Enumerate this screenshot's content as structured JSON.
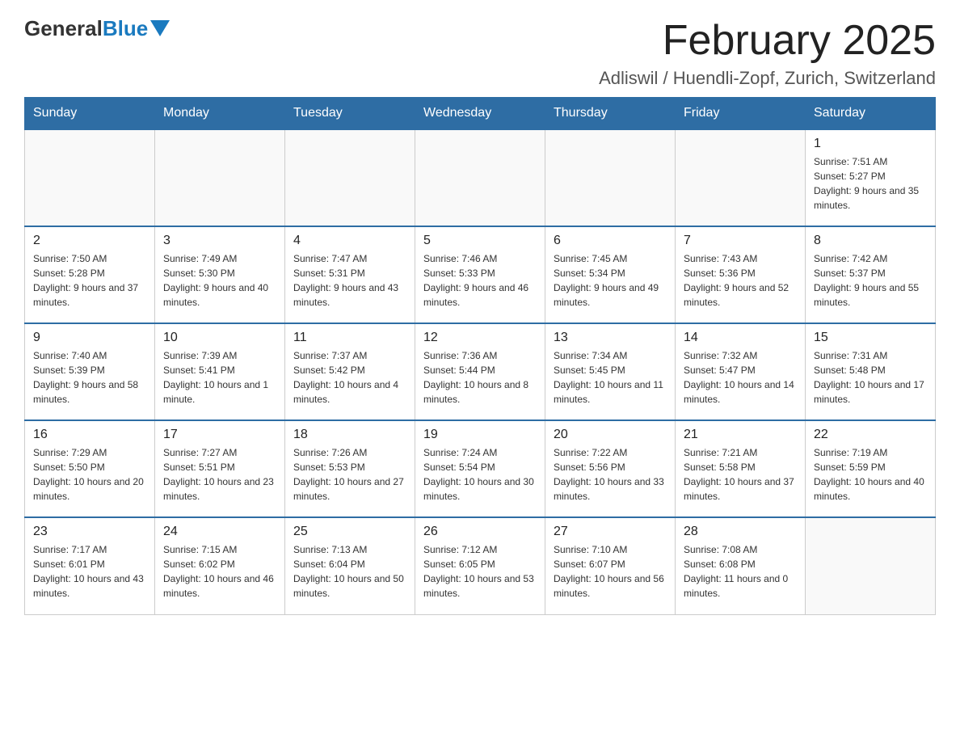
{
  "header": {
    "logo": {
      "general": "General",
      "blue": "Blue"
    },
    "title": "February 2025",
    "location": "Adliswil / Huendli-Zopf, Zurich, Switzerland"
  },
  "weekdays": [
    "Sunday",
    "Monday",
    "Tuesday",
    "Wednesday",
    "Thursday",
    "Friday",
    "Saturday"
  ],
  "weeks": [
    [
      {
        "day": "",
        "info": ""
      },
      {
        "day": "",
        "info": ""
      },
      {
        "day": "",
        "info": ""
      },
      {
        "day": "",
        "info": ""
      },
      {
        "day": "",
        "info": ""
      },
      {
        "day": "",
        "info": ""
      },
      {
        "day": "1",
        "info": "Sunrise: 7:51 AM\nSunset: 5:27 PM\nDaylight: 9 hours and 35 minutes."
      }
    ],
    [
      {
        "day": "2",
        "info": "Sunrise: 7:50 AM\nSunset: 5:28 PM\nDaylight: 9 hours and 37 minutes."
      },
      {
        "day": "3",
        "info": "Sunrise: 7:49 AM\nSunset: 5:30 PM\nDaylight: 9 hours and 40 minutes."
      },
      {
        "day": "4",
        "info": "Sunrise: 7:47 AM\nSunset: 5:31 PM\nDaylight: 9 hours and 43 minutes."
      },
      {
        "day": "5",
        "info": "Sunrise: 7:46 AM\nSunset: 5:33 PM\nDaylight: 9 hours and 46 minutes."
      },
      {
        "day": "6",
        "info": "Sunrise: 7:45 AM\nSunset: 5:34 PM\nDaylight: 9 hours and 49 minutes."
      },
      {
        "day": "7",
        "info": "Sunrise: 7:43 AM\nSunset: 5:36 PM\nDaylight: 9 hours and 52 minutes."
      },
      {
        "day": "8",
        "info": "Sunrise: 7:42 AM\nSunset: 5:37 PM\nDaylight: 9 hours and 55 minutes."
      }
    ],
    [
      {
        "day": "9",
        "info": "Sunrise: 7:40 AM\nSunset: 5:39 PM\nDaylight: 9 hours and 58 minutes."
      },
      {
        "day": "10",
        "info": "Sunrise: 7:39 AM\nSunset: 5:41 PM\nDaylight: 10 hours and 1 minute."
      },
      {
        "day": "11",
        "info": "Sunrise: 7:37 AM\nSunset: 5:42 PM\nDaylight: 10 hours and 4 minutes."
      },
      {
        "day": "12",
        "info": "Sunrise: 7:36 AM\nSunset: 5:44 PM\nDaylight: 10 hours and 8 minutes."
      },
      {
        "day": "13",
        "info": "Sunrise: 7:34 AM\nSunset: 5:45 PM\nDaylight: 10 hours and 11 minutes."
      },
      {
        "day": "14",
        "info": "Sunrise: 7:32 AM\nSunset: 5:47 PM\nDaylight: 10 hours and 14 minutes."
      },
      {
        "day": "15",
        "info": "Sunrise: 7:31 AM\nSunset: 5:48 PM\nDaylight: 10 hours and 17 minutes."
      }
    ],
    [
      {
        "day": "16",
        "info": "Sunrise: 7:29 AM\nSunset: 5:50 PM\nDaylight: 10 hours and 20 minutes."
      },
      {
        "day": "17",
        "info": "Sunrise: 7:27 AM\nSunset: 5:51 PM\nDaylight: 10 hours and 23 minutes."
      },
      {
        "day": "18",
        "info": "Sunrise: 7:26 AM\nSunset: 5:53 PM\nDaylight: 10 hours and 27 minutes."
      },
      {
        "day": "19",
        "info": "Sunrise: 7:24 AM\nSunset: 5:54 PM\nDaylight: 10 hours and 30 minutes."
      },
      {
        "day": "20",
        "info": "Sunrise: 7:22 AM\nSunset: 5:56 PM\nDaylight: 10 hours and 33 minutes."
      },
      {
        "day": "21",
        "info": "Sunrise: 7:21 AM\nSunset: 5:58 PM\nDaylight: 10 hours and 37 minutes."
      },
      {
        "day": "22",
        "info": "Sunrise: 7:19 AM\nSunset: 5:59 PM\nDaylight: 10 hours and 40 minutes."
      }
    ],
    [
      {
        "day": "23",
        "info": "Sunrise: 7:17 AM\nSunset: 6:01 PM\nDaylight: 10 hours and 43 minutes."
      },
      {
        "day": "24",
        "info": "Sunrise: 7:15 AM\nSunset: 6:02 PM\nDaylight: 10 hours and 46 minutes."
      },
      {
        "day": "25",
        "info": "Sunrise: 7:13 AM\nSunset: 6:04 PM\nDaylight: 10 hours and 50 minutes."
      },
      {
        "day": "26",
        "info": "Sunrise: 7:12 AM\nSunset: 6:05 PM\nDaylight: 10 hours and 53 minutes."
      },
      {
        "day": "27",
        "info": "Sunrise: 7:10 AM\nSunset: 6:07 PM\nDaylight: 10 hours and 56 minutes."
      },
      {
        "day": "28",
        "info": "Sunrise: 7:08 AM\nSunset: 6:08 PM\nDaylight: 11 hours and 0 minutes."
      },
      {
        "day": "",
        "info": ""
      }
    ]
  ]
}
